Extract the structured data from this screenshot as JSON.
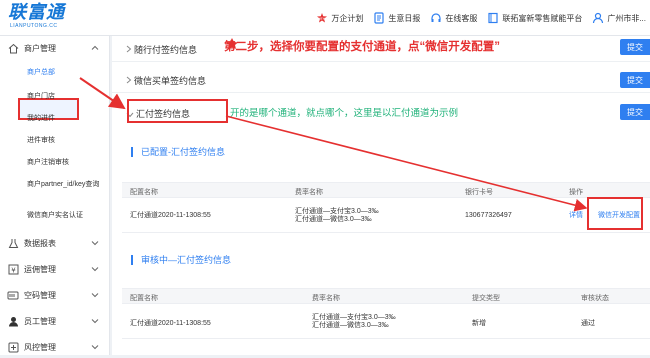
{
  "header": {
    "logo_text": "联富通",
    "logo_sub": "LIANPUTONG.CC",
    "nav": [
      {
        "icon": "new-badge-icon",
        "label": "万企计划"
      },
      {
        "icon": "document-icon",
        "label": "生意日报"
      },
      {
        "icon": "headset-icon",
        "label": "在线客服"
      },
      {
        "icon": "book-icon",
        "label": "联拓富新零售赋能平台"
      },
      {
        "icon": "user-icon",
        "label": "广州市非..."
      }
    ]
  },
  "sidebar": {
    "groups": [
      {
        "icon": "home-icon",
        "label": "商户管理"
      },
      {
        "icon": "flask-icon",
        "label": "数据报表"
      },
      {
        "icon": "yen-icon",
        "label": "运佣管理"
      },
      {
        "icon": "code-icon",
        "label": "空码管理"
      },
      {
        "icon": "person-icon",
        "label": "员工管理"
      },
      {
        "icon": "shield-plus-icon",
        "label": "风控管理"
      }
    ],
    "sub_items": [
      "商户总部",
      "商户门店",
      "我的进件",
      "进件审核",
      "商户注销审核",
      "商户partner_id/key查询",
      "微信商户实名认证"
    ]
  },
  "main": {
    "sections": [
      {
        "label": "随行付签约信息",
        "button": "提交"
      },
      {
        "label": "微信买单签约信息",
        "button": "提交"
      },
      {
        "label": "汇付签约信息",
        "button": "提交"
      }
    ],
    "annotation_step2": "第二步，选择你要配置的支付通道，点“微信开发配置”",
    "annotation_hint": "开的是哪个通道，就点哪个，这里是以汇付通道为示例",
    "configured": {
      "title": "已配置-汇付签约信息",
      "headers": [
        "配置名称",
        "费率名称",
        "银行卡号",
        "操作"
      ],
      "row": {
        "name": "汇付通道2020-11-1308:55",
        "rate_line1": "汇付通道—支付宝3.0—3‰",
        "rate_line2": "汇付通道—微信3.0—3‰",
        "card": "130677326497",
        "action_detail": "详情",
        "action_config": "微信开发配置"
      }
    },
    "reviewing": {
      "title": "审核中—汇付签约信息",
      "headers": [
        "配置名称",
        "费率名称",
        "提交类型",
        "审核状态"
      ],
      "row": {
        "name": "汇付通道2020-11-1308:55",
        "rate_line1": "汇付通道—支付宝3.0—3‰",
        "rate_line2": "汇付通道—微信3.0—3‰",
        "submit_type": "新增",
        "status": "通过"
      }
    }
  },
  "colors": {
    "accent": "#2f7ff0",
    "annotation_red": "#e53030",
    "annotation_green": "#20b27a"
  }
}
